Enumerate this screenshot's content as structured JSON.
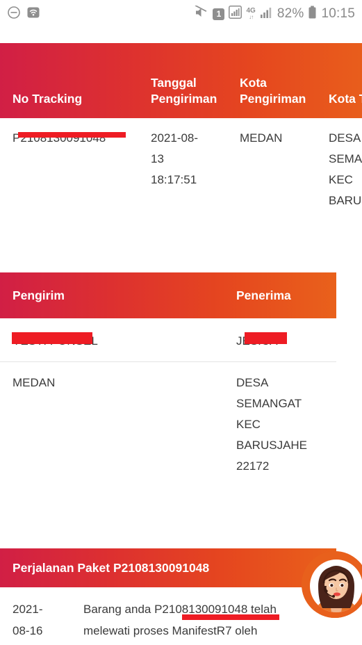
{
  "statusbar": {
    "icons_left": [
      "do-not-disturb-icon",
      "hotspot-icon"
    ],
    "icons_right": [
      "mute-icon",
      "sim-1-icon",
      "signal-box-icon",
      "4g-data-icon",
      "signal-bars-icon"
    ],
    "sim_label": "1",
    "network_label": "4G",
    "network_arrows": "↓↑",
    "battery_percent": "82%",
    "clock": "10:15"
  },
  "theme": {
    "gradient_start": "#d11f45",
    "gradient_mid": "#dd3030",
    "gradient_end": "#e9611b",
    "redaction_color": "#ee1c24",
    "text_color": "#3b3b3b",
    "header_text_color": "#ffffff"
  },
  "shipment_table": {
    "headers": [
      "No Tracking",
      "Tanggal\nPengiriman",
      "Kota\nPengiriman",
      "Kota T"
    ],
    "rows": [
      {
        "no_tracking": "P2108130091048",
        "tanggal_pengiriman": "2021-08-\n13\n18:17:51",
        "kota_pengiriman": "MEDAN",
        "kota_tujuan": "DESA\nSEMA\nKEC\nBARU"
      }
    ]
  },
  "party_table": {
    "headers": [
      "Pengirim",
      "Penerima"
    ],
    "rows": [
      {
        "pengirim": "YESTI PONSEL",
        "penerima": "JESICA"
      },
      {
        "pengirim": "MEDAN",
        "penerima": "DESA\nSEMANGAT\nKEC\nBARUSJAHE\n22172"
      }
    ]
  },
  "journey_section": {
    "title": "Perjalanan Paket P2108130091048",
    "rows": [
      {
        "date": "2021-\n08-16",
        "description": "Barang anda P2108130091048 telah\nmelewati proses ManifestR7 oleh"
      }
    ]
  },
  "chat_widget": {
    "icon": "support-agent-avatar-icon"
  }
}
